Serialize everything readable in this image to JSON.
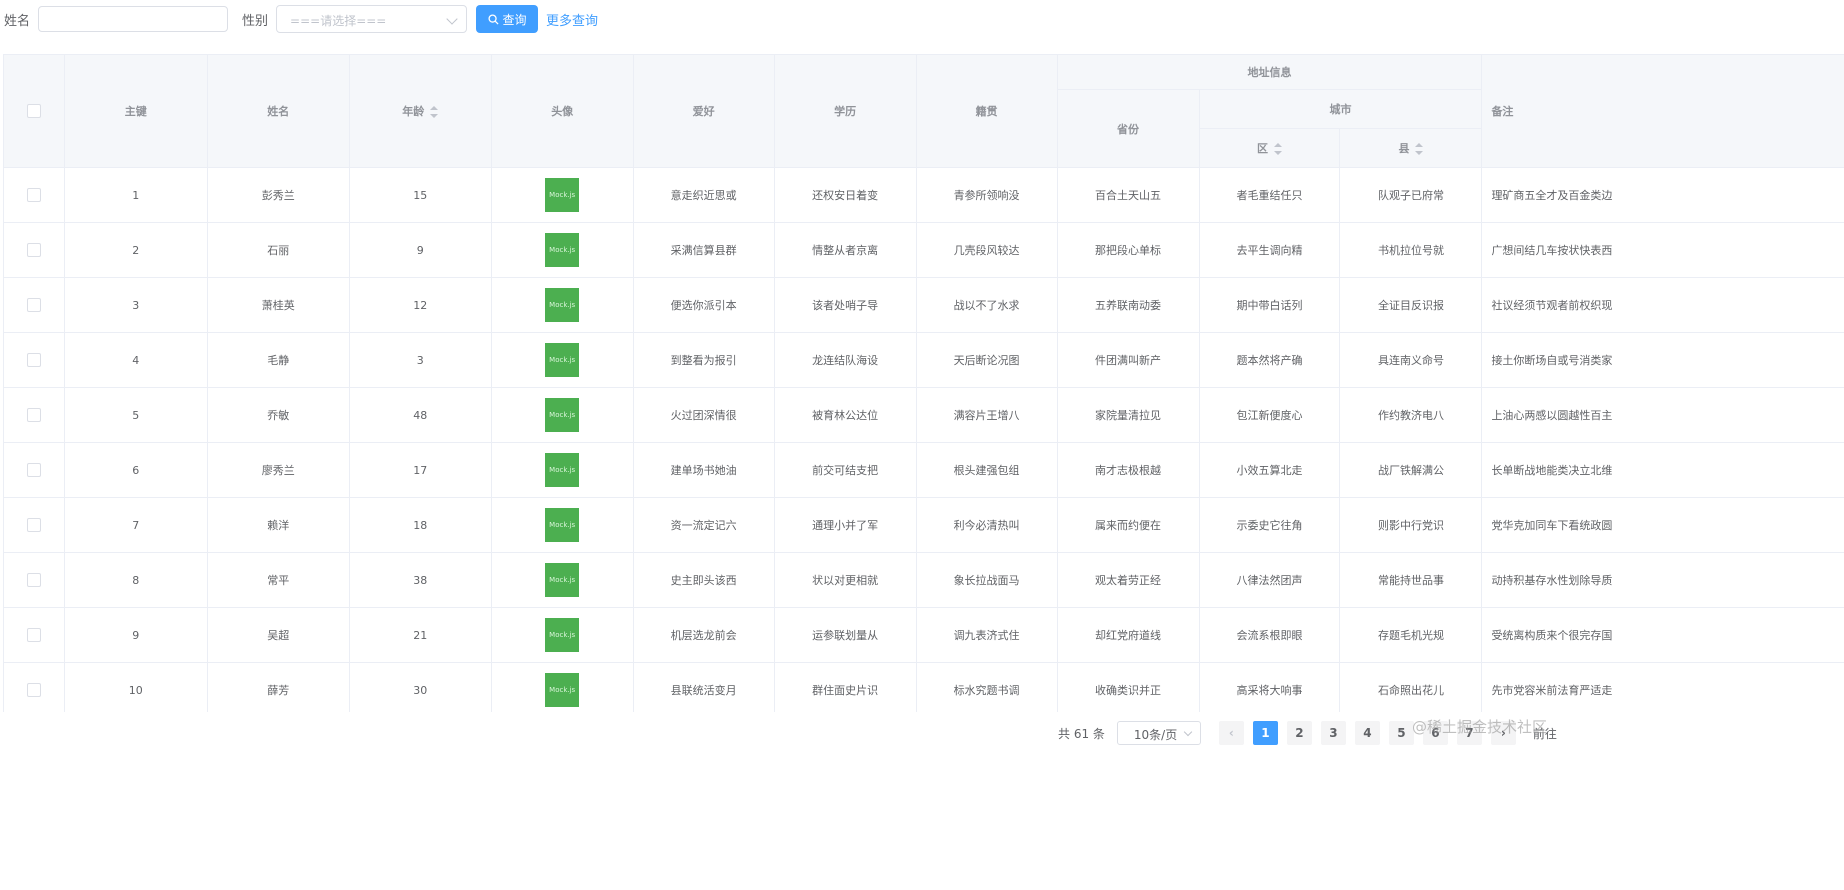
{
  "search": {
    "name_label": "姓名",
    "gender_label": "性别",
    "gender_placeholder": "===请选择===",
    "query_label": "查询",
    "more_label": "更多查询"
  },
  "table": {
    "headers": {
      "key": "主键",
      "name": "姓名",
      "age": "年龄",
      "avatar": "头像",
      "hobby": "爱好",
      "education": "学历",
      "native": "籍贯",
      "address": "地址信息",
      "province": "省份",
      "city": "城市",
      "district": "区",
      "county": "县",
      "remark": "备注"
    },
    "avatar_text": "Mock.js",
    "rows": [
      {
        "id": "1",
        "name": "彭秀兰",
        "age": "15",
        "hobby": "意走织近思或",
        "education": "还权安日着变",
        "native": "青参所领响没",
        "province": "百合土天山五",
        "district": "者毛重结任只",
        "county": "队观子已府常",
        "remark": "理矿商五全才及百金类边"
      },
      {
        "id": "2",
        "name": "石丽",
        "age": "9",
        "hobby": "采满信算县群",
        "education": "情整从者京离",
        "native": "几壳段风较达",
        "province": "那把段心单标",
        "district": "去平生调向精",
        "county": "书机拉位号就",
        "remark": "广想间结几车按状快表西"
      },
      {
        "id": "3",
        "name": "萧桂英",
        "age": "12",
        "hobby": "便选你派引本",
        "education": "该者处哨子导",
        "native": "战以不了水求",
        "province": "五养联南动委",
        "district": "期中带白话列",
        "county": "全证目反识报",
        "remark": "社议经须节观者前权织现"
      },
      {
        "id": "4",
        "name": "毛静",
        "age": "3",
        "hobby": "到整看为报引",
        "education": "龙连结队海设",
        "native": "天后断论况图",
        "province": "件团满叫新产",
        "district": "题本然将产确",
        "county": "具连南义命号",
        "remark": "接土你断场自或号消类家"
      },
      {
        "id": "5",
        "name": "乔敏",
        "age": "48",
        "hobby": "火过团深情很",
        "education": "被育林公达位",
        "native": "满容片王增八",
        "province": "家院量清拉见",
        "district": "包江新便度心",
        "county": "作约教济电八",
        "remark": "上油心两感以圆越性百主"
      },
      {
        "id": "6",
        "name": "廖秀兰",
        "age": "17",
        "hobby": "建单场书她油",
        "education": "前交可结支把",
        "native": "根头建强包组",
        "province": "南才志极根越",
        "district": "小效五算北走",
        "county": "战厂铁解满公",
        "remark": "长单断战地能类决立北维"
      },
      {
        "id": "7",
        "name": "赖洋",
        "age": "18",
        "hobby": "资一流定记六",
        "education": "通理小并了军",
        "native": "利今必清热叫",
        "province": "属来而约便在",
        "district": "示委史它往角",
        "county": "则影中行党识",
        "remark": "党华克加同车下看统政圆"
      },
      {
        "id": "8",
        "name": "常平",
        "age": "38",
        "hobby": "史主即头该西",
        "education": "状以对更相就",
        "native": "象长拉战面马",
        "province": "观太着劳正经",
        "district": "八律法然团声",
        "county": "常能持世品事",
        "remark": "动持积基存水性划除导质"
      },
      {
        "id": "9",
        "name": "吴超",
        "age": "21",
        "hobby": "机层选龙前会",
        "education": "运参联划量从",
        "native": "调九表济式住",
        "province": "却红党府道线",
        "district": "会流系根即眼",
        "county": "存题毛机光规",
        "remark": "受统离构质来个很完存国"
      },
      {
        "id": "10",
        "name": "薛芳",
        "age": "30",
        "hobby": "县联统活变月",
        "education": "群住面史片识",
        "native": "标水究题书调",
        "province": "收确类识并正",
        "district": "高采将大响事",
        "county": "石命照出花儿",
        "remark": "先市党容米前法育严适走"
      }
    ]
  },
  "pagination": {
    "total_text": "共 61 条",
    "page_size": "10条/页",
    "prev": "‹",
    "pages": [
      "1",
      "2",
      "3",
      "4",
      "5",
      "6",
      "7"
    ],
    "next": "›",
    "goto_label": "前往"
  },
  "watermark": "@稀土掘金技术社区"
}
